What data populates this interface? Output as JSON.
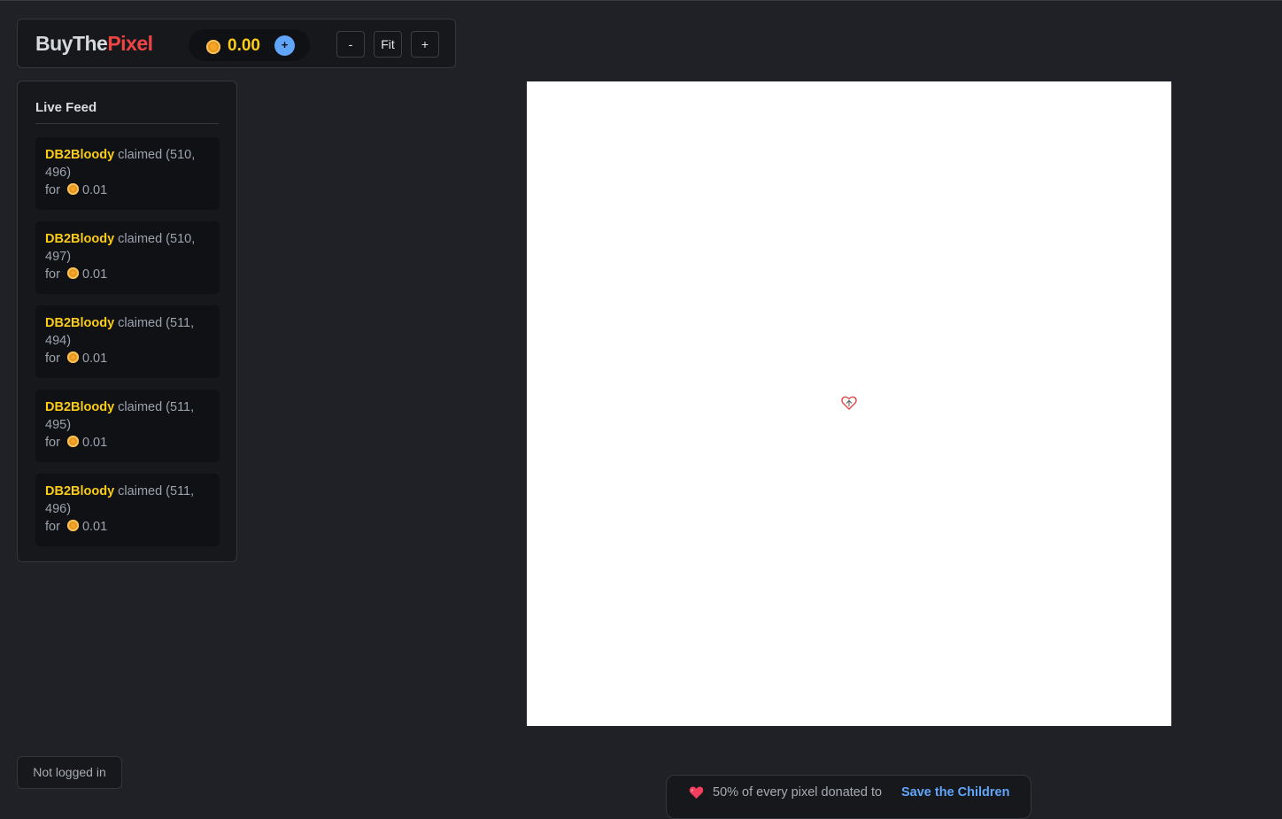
{
  "header": {
    "logo_part1": "BuyThe",
    "logo_part2": "Pixel",
    "balance": "0.00",
    "add_funds_label": "+",
    "zoom_out_label": "-",
    "zoom_fit_label": "Fit",
    "zoom_in_label": "+"
  },
  "feed": {
    "title": "Live Feed",
    "items": [
      {
        "user": "DB2Bloody",
        "action": " claimed (510, 496)",
        "for_label": "for",
        "price": "0.01"
      },
      {
        "user": "DB2Bloody",
        "action": " claimed (510, 497)",
        "for_label": "for",
        "price": "0.01"
      },
      {
        "user": "DB2Bloody",
        "action": " claimed (511, 494)",
        "for_label": "for",
        "price": "0.01"
      },
      {
        "user": "DB2Bloody",
        "action": " claimed (511, 495)",
        "for_label": "for",
        "price": "0.01"
      },
      {
        "user": "DB2Bloody",
        "action": " claimed (511, 496)",
        "for_label": "for",
        "price": "0.01"
      }
    ]
  },
  "login_status": "Not logged in",
  "donation": {
    "text": "50% of every pixel donated to",
    "link": "Save the Children"
  },
  "colors": {
    "background": "#1f2126",
    "accent_red": "#ef4444",
    "accent_yellow": "#facc15",
    "accent_blue": "#60a5fa",
    "coin": "#f4a62a"
  },
  "icons": {
    "coin": "coin-icon",
    "heart": "heart-icon",
    "canvas_marker": "heart-cursor-icon"
  }
}
